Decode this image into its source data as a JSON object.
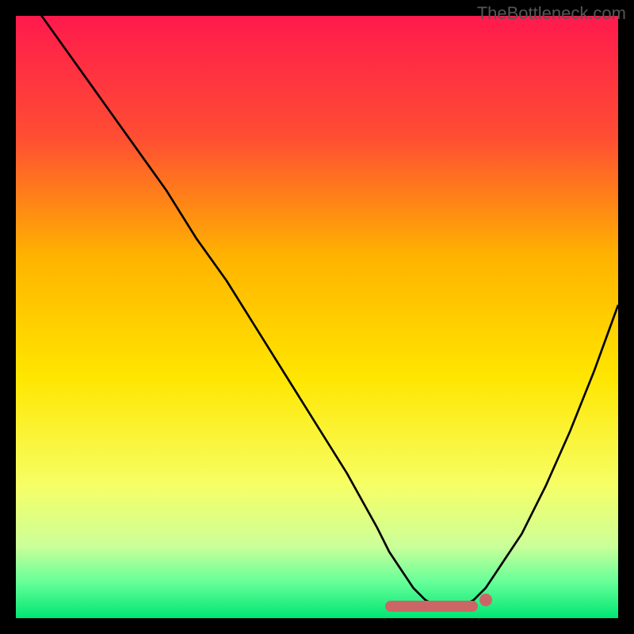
{
  "watermark": "TheBottleneck.com",
  "chart_data": {
    "type": "line",
    "title": "",
    "xlabel": "",
    "ylabel": "",
    "xlim": [
      0,
      100
    ],
    "ylim": [
      0,
      100
    ],
    "x": [
      0,
      5,
      10,
      15,
      20,
      25,
      30,
      35,
      40,
      45,
      50,
      55,
      60,
      62,
      64,
      66,
      68,
      70,
      72,
      74,
      76,
      78,
      80,
      84,
      88,
      92,
      96,
      100
    ],
    "values": [
      106,
      99,
      92,
      85,
      78,
      71,
      63,
      56,
      48,
      40,
      32,
      24,
      15,
      11,
      8,
      5,
      3,
      2,
      2,
      2,
      3,
      5,
      8,
      14,
      22,
      31,
      41,
      52
    ],
    "marker_band": {
      "x_start": 62,
      "x_end": 76,
      "y": 2
    },
    "marker_dot": {
      "x": 78,
      "y": 3
    },
    "gradient_stops": [
      {
        "pos": 0.0,
        "color": "#ff1a4d"
      },
      {
        "pos": 0.2,
        "color": "#ff4d33"
      },
      {
        "pos": 0.4,
        "color": "#ffb300"
      },
      {
        "pos": 0.6,
        "color": "#ffe600"
      },
      {
        "pos": 0.78,
        "color": "#f6ff66"
      },
      {
        "pos": 0.88,
        "color": "#ccff99"
      },
      {
        "pos": 0.94,
        "color": "#66ff99"
      },
      {
        "pos": 1.0,
        "color": "#00e673"
      }
    ]
  }
}
